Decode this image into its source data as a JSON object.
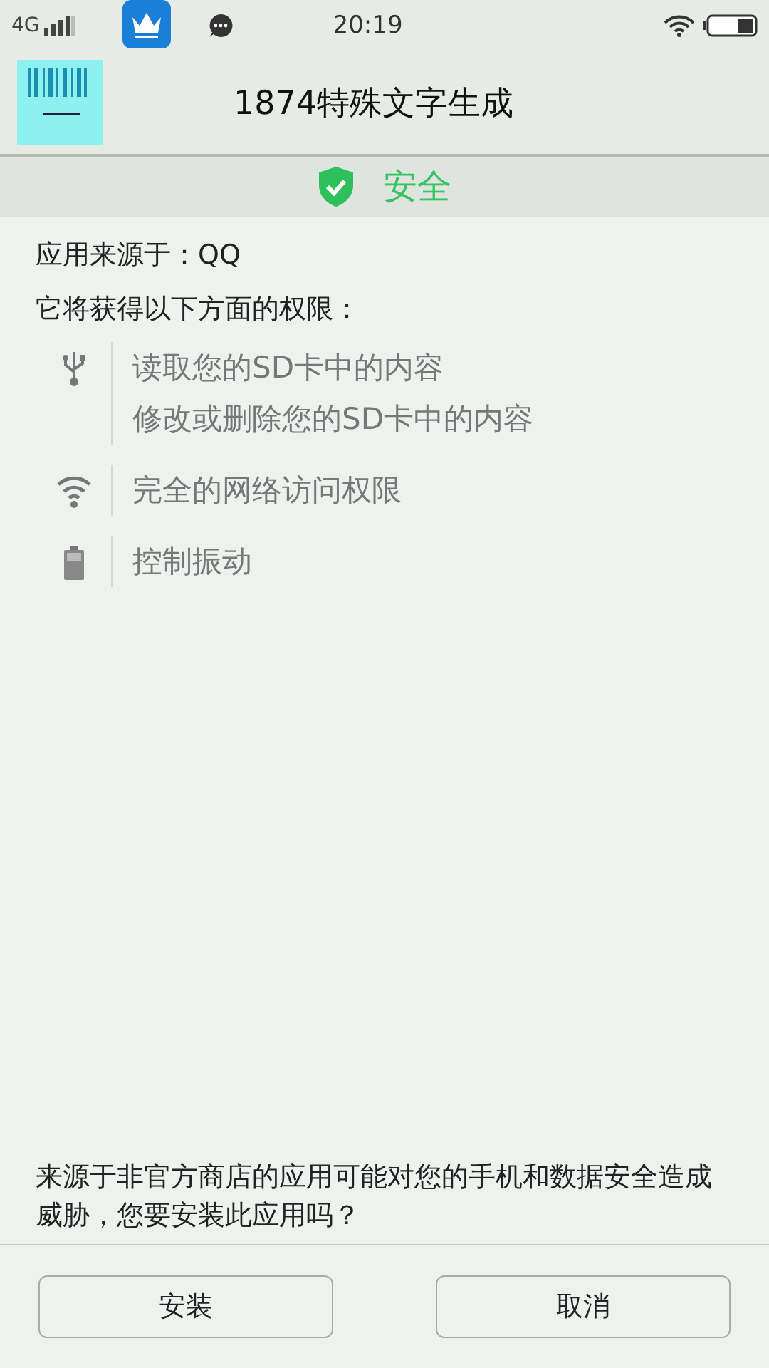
{
  "status_bar": {
    "network": "4G",
    "time": "20:19"
  },
  "header": {
    "title": "1874特殊文字生成"
  },
  "safety": {
    "label": "安全"
  },
  "source": "应用来源于：QQ",
  "permissions_title": "它将获得以下方面的权限：",
  "permissions": [
    {
      "kind": "usb",
      "items": [
        "读取您的SD卡中的内容",
        "修改或删除您的SD卡中的内容"
      ]
    },
    {
      "kind": "wifi",
      "items": [
        "完全的网络访问权限"
      ]
    },
    {
      "kind": "battery",
      "items": [
        "控制振动"
      ]
    }
  ],
  "warning": "来源于非官方商店的应用可能对您的手机和数据安全造成威胁，您要安装此应用吗？",
  "buttons": [
    "安装",
    "取消"
  ]
}
